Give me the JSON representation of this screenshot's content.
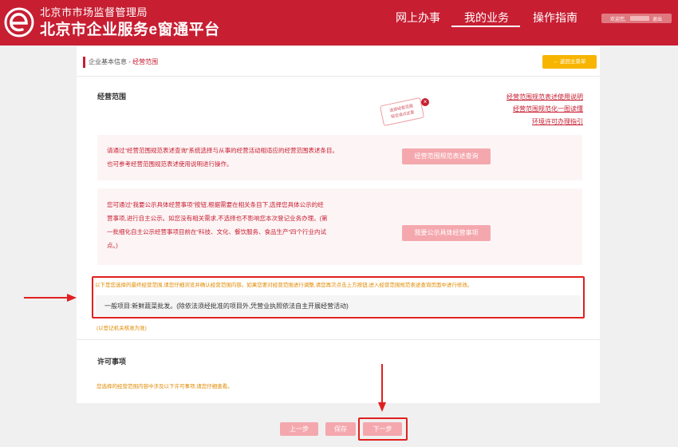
{
  "header": {
    "org_name": "北京市市场监督管理局",
    "platform_name": "北京市企业服务e窗通平台",
    "nav": [
      "网上办事",
      "我的业务",
      "操作指南"
    ],
    "active_nav": "我的业务",
    "welcome": "欢迎您,",
    "logout": "退出"
  },
  "breadcrumb": {
    "parent": "企业基本信息 - ",
    "current": "经营范围"
  },
  "back_button": "← 返回主菜单",
  "scope_section": {
    "title": "经营范围",
    "links": [
      "经营范围规范表述使用说明",
      "经营范围规范化一图读懂",
      "环境许可办理指引"
    ],
    "stamp_text_1": "选择经营范围",
    "stamp_text_2": "规范请点这里",
    "stamp_close": "×",
    "box1_line1": "请通过“经营范围规范表述查询”系统选择与从事的经营活动相适应的经营范围表述条目。",
    "box1_line2": "也可参考经营范围规范表述使用说明进行操作。",
    "box1_button": "经营范围规范表述查询",
    "box2_line1": "您可通过“我要公示具体经营事项”按钮,根据需要在相关条目下,选择您具体公示的经",
    "box2_line2": "营事项,进行自主公示。如您没有相关需求,不选择也不影响您本次登记业务办理。(第",
    "box2_line3": "一批细化自主公示经营事项目前在“科技、文化、餐饮服务、食品生产”四个行业内试",
    "box2_line4": "点。)",
    "box2_button": "我要公示具体经营事项",
    "notice": "以下是您选择的最终经营范围,请您仔细浏览并确认经营范围内容。如果您要对经营范围进行调整,请您再次点击上方按钮,进入经营范围规范表述查询页面中进行修改。",
    "scope_value": "一般项目:新鲜蔬菜批发。(除依法须经批准的项目外,凭营业执照依法自主开展经营活动)",
    "registration_note": "(以登记机关核准为准)"
  },
  "permit_section": {
    "title": "许可事项",
    "note": "您选择的经营范围内容中涉及以下许可事项,请您仔细查看。"
  },
  "footer": {
    "prev": "上一步",
    "save": "保存",
    "next": "下一步"
  },
  "colors": {
    "brand_red": "#c71e32",
    "button_pink": "#f4a8ae",
    "notice_orange": "#e08a00",
    "back_yellow": "#f7b500",
    "highlight_red": "#e02020"
  }
}
